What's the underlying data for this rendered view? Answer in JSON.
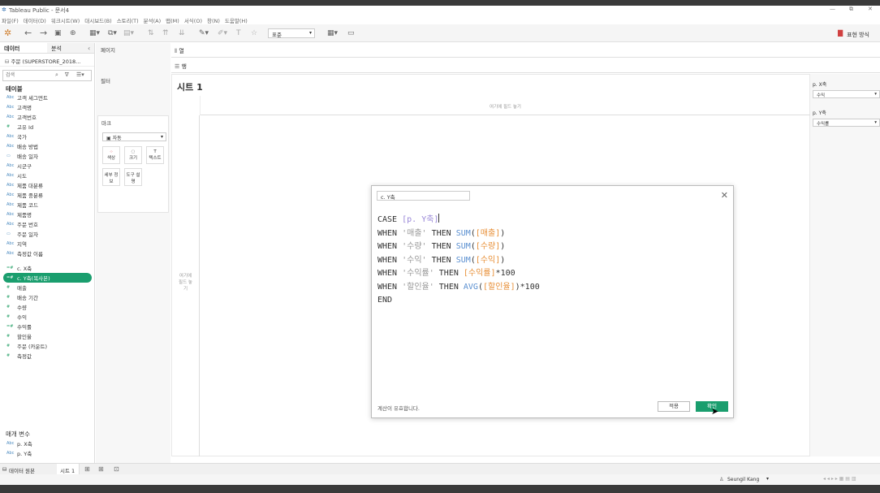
{
  "window": {
    "title": "Tableau Public - 문서4",
    "controls": [
      "—",
      "⧉",
      "✕"
    ]
  },
  "menu": [
    "파일(F)",
    "데이터(D)",
    "워크시트(W)",
    "대시보드(B)",
    "스토리(T)",
    "분석(A)",
    "맵(M)",
    "서식(O)",
    "창(N)",
    "도움말(H)"
  ],
  "toolbar": {
    "show_me": "표현 방식",
    "fit_select": "표준"
  },
  "left": {
    "tab_data": "데이터",
    "tab_analysis": "분석",
    "datasource": "주문 (SUPERSTORE_2018...",
    "search_placeholder": "검색",
    "tables_header": "테이블",
    "fields": [
      {
        "type": "Abc",
        "name": "고객 세그먼트"
      },
      {
        "type": "Abc",
        "name": "고객명"
      },
      {
        "type": "Abc",
        "name": "고객번호"
      },
      {
        "type": "#",
        "name": "고유 Id"
      },
      {
        "type": "Abc",
        "name": "국가"
      },
      {
        "type": "Abc",
        "name": "배송 방법"
      },
      {
        "type": "▭",
        "name": "배송 일자"
      },
      {
        "type": "Abc",
        "name": "시군구"
      },
      {
        "type": "Abc",
        "name": "시도"
      },
      {
        "type": "Abc",
        "name": "제품 대분류"
      },
      {
        "type": "Abc",
        "name": "제품 중분류"
      },
      {
        "type": "Abc",
        "name": "제품 코드"
      },
      {
        "type": "Abc",
        "name": "제품명"
      },
      {
        "type": "Abc",
        "name": "주문 번호"
      },
      {
        "type": "▭",
        "name": "주문 일자"
      },
      {
        "type": "Abc",
        "name": "지역"
      },
      {
        "type": "Abc",
        "name": "측정값 이름"
      }
    ],
    "measures": [
      {
        "type": "=#",
        "name": "c. X축"
      },
      {
        "type": "=#",
        "name": "c. Y축(복사본)",
        "selected": true
      },
      {
        "type": "#",
        "name": "매출"
      },
      {
        "type": "#",
        "name": "배송 기간"
      },
      {
        "type": "#",
        "name": "수량"
      },
      {
        "type": "#",
        "name": "수익"
      },
      {
        "type": "=#",
        "name": "수익률"
      },
      {
        "type": "#",
        "name": "할인율"
      },
      {
        "type": "#",
        "name": "주문 (카운트)"
      },
      {
        "type": "#",
        "name": "측정값"
      }
    ],
    "params_header": "매개 변수",
    "params": [
      {
        "type": "Abc",
        "name": "p. X축"
      },
      {
        "type": "Abc",
        "name": "p. Y축"
      }
    ]
  },
  "mid": {
    "pages": "페이지",
    "filters": "필터",
    "marks": "마크",
    "mark_type": "자동",
    "mark_buttons": [
      "색상",
      "크기",
      "텍스트",
      "세부 정보",
      "도구 설명"
    ]
  },
  "shelves": {
    "columns": "열",
    "rows": "행"
  },
  "sheet": {
    "title": "시트 1",
    "drop_top": "여기에 필드 놓기",
    "drop_left": "여기에 필드 놓기"
  },
  "right": {
    "p1_label": "p. X축",
    "p1_value": "수익",
    "p2_label": "p. Y축",
    "p2_value": "수익률"
  },
  "dialog": {
    "name": "c. Y축",
    "lines": [
      [
        {
          "t": "CASE ",
          "c": "kw"
        },
        {
          "t": "[p. Y축]",
          "c": "param"
        }
      ],
      [
        {
          "t": "WHEN ",
          "c": "kw"
        },
        {
          "t": "'매출'",
          "c": "str"
        },
        {
          "t": " THEN ",
          "c": "kw"
        },
        {
          "t": "SUM",
          "c": "fn"
        },
        {
          "t": "(",
          "c": "kw"
        },
        {
          "t": "[매출]",
          "c": "fld"
        },
        {
          "t": ")",
          "c": "kw"
        }
      ],
      [
        {
          "t": "WHEN ",
          "c": "kw"
        },
        {
          "t": "'수량'",
          "c": "str"
        },
        {
          "t": " THEN ",
          "c": "kw"
        },
        {
          "t": "SUM",
          "c": "fn"
        },
        {
          "t": "(",
          "c": "kw"
        },
        {
          "t": "[수량]",
          "c": "fld"
        },
        {
          "t": ")",
          "c": "kw"
        }
      ],
      [
        {
          "t": "WHEN ",
          "c": "kw"
        },
        {
          "t": "'수익'",
          "c": "str"
        },
        {
          "t": " THEN ",
          "c": "kw"
        },
        {
          "t": "SUM",
          "c": "fn"
        },
        {
          "t": "(",
          "c": "kw"
        },
        {
          "t": "[수익]",
          "c": "fld"
        },
        {
          "t": ")",
          "c": "kw"
        }
      ],
      [
        {
          "t": "WHEN ",
          "c": "kw"
        },
        {
          "t": "'수익률'",
          "c": "str"
        },
        {
          "t": " THEN ",
          "c": "kw"
        },
        {
          "t": "[수익률]",
          "c": "fld"
        },
        {
          "t": "*100",
          "c": "kw"
        }
      ],
      [
        {
          "t": "WHEN ",
          "c": "kw"
        },
        {
          "t": "'할인율'",
          "c": "str"
        },
        {
          "t": " THEN ",
          "c": "kw"
        },
        {
          "t": "AVG",
          "c": "fn"
        },
        {
          "t": "(",
          "c": "kw"
        },
        {
          "t": "[할인율]",
          "c": "fld"
        },
        {
          "t": ")*100",
          "c": "kw"
        }
      ],
      [
        {
          "t": "END",
          "c": "kw"
        }
      ]
    ],
    "valid_msg": "계산이 유효합니다.",
    "apply": "적용",
    "ok": "확인"
  },
  "bottom": {
    "datasource_tab": "데이터 원본",
    "sheet_tab": "시트 1"
  },
  "status": {
    "user": "Seungil Kang"
  }
}
